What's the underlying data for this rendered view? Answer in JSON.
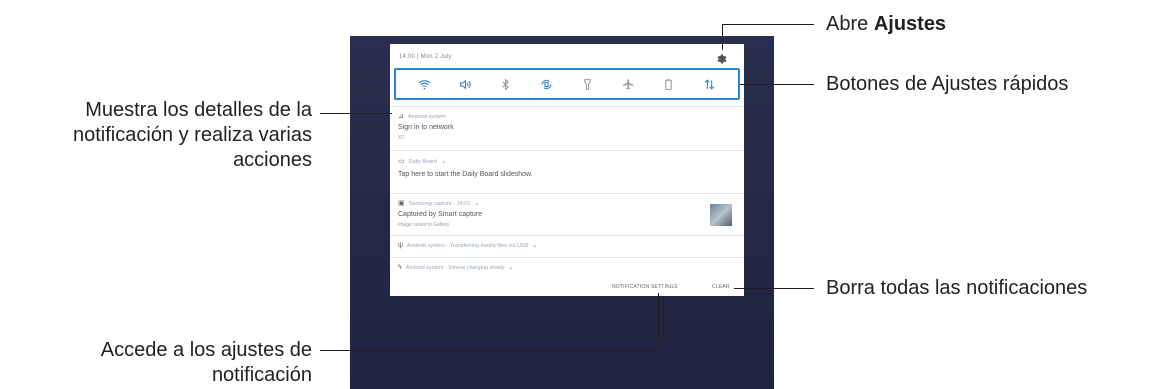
{
  "status_bar": {
    "time_date": "14:00 | Mon 2 July",
    "settings_icon": "gear-icon"
  },
  "quick_settings": {
    "buttons": [
      {
        "name": "wifi-icon",
        "active": true
      },
      {
        "name": "sound-icon",
        "active": true
      },
      {
        "name": "bluetooth-icon",
        "active": false
      },
      {
        "name": "auto-rotate-icon",
        "active": true
      },
      {
        "name": "flashlight-icon",
        "active": false
      },
      {
        "name": "airplane-mode-icon",
        "active": false
      },
      {
        "name": "power-saving-icon",
        "active": false
      },
      {
        "name": "mobile-data-icon",
        "active": true
      }
    ]
  },
  "notifications": [
    {
      "app": "Android system",
      "title": "Sign in to network",
      "subtitle": "XT"
    },
    {
      "app": "Daily Board",
      "title": "Tap here to start the Daily Board slideshow."
    },
    {
      "app": "Samsung capture · 14:01",
      "title": "Captured by Smart capture",
      "subtitle": "Image saved in Gallery"
    },
    {
      "app": "Android system · Transferring media files via USB"
    },
    {
      "app": "Android system · Device charging slowly"
    }
  ],
  "footer": {
    "notification_settings": "NOTIFICATION SETTINGS",
    "clear": "CLEAR"
  },
  "callouts": {
    "open_settings_prefix": "Abre ",
    "open_settings_bold": "Ajustes",
    "quick_settings": "Botones de Ajustes rápidos",
    "details_line1": "Muestra los detalles de la",
    "details_line2": "notificación y realiza varias",
    "details_line3": "acciones",
    "clear_all": "Borra todas las notificaciones",
    "access_settings_line1": "Accede a los ajustes de",
    "access_settings_line2": "notificación"
  },
  "colors": {
    "accent": "#2a86c8",
    "wallpaper": "#262a48",
    "text": "#231f20"
  }
}
